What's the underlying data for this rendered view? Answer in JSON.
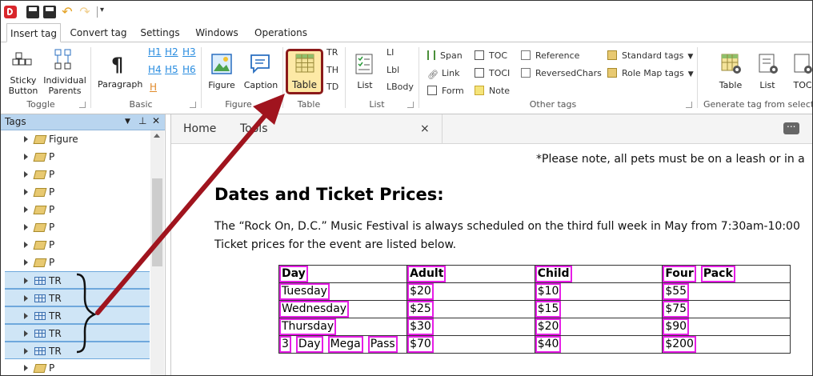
{
  "qat": {
    "icons": [
      "app-logo-icon",
      "save-icon",
      "save-as-icon",
      "undo-icon",
      "redo-icon",
      "customize-dropdown-icon"
    ]
  },
  "ribbon_tabs": [
    "Insert tag",
    "Convert tag",
    "Settings",
    "Windows",
    "Operations"
  ],
  "toggle_group": {
    "sticky": "Sticky Button",
    "individual": "Individual Parents",
    "label": "Toggle"
  },
  "basic_group": {
    "paragraph": "Paragraph",
    "h1": "H1",
    "h2": "H2",
    "h3": "H3",
    "h4": "H4",
    "h5": "H5",
    "h6": "H6",
    "h": "H",
    "label": "Basic"
  },
  "figure_group": {
    "figure": "Figure",
    "caption": "Caption",
    "label": "Figure"
  },
  "table_group": {
    "table": "Table",
    "tr": "TR",
    "th": "TH",
    "td": "TD",
    "label": "Table"
  },
  "list_group": {
    "list": "List",
    "li": "LI",
    "lbl": "Lbl",
    "lbody": "LBody",
    "label": "List"
  },
  "other_group": {
    "span": "Span",
    "link": "Link",
    "form": "Form",
    "toc": "TOC",
    "toci": "TOCI",
    "note": "Note",
    "reference": "Reference",
    "reversed": "ReversedChars",
    "standard": "Standard tags",
    "rolemap": "Role Map tags",
    "label": "Other tags"
  },
  "generate_group": {
    "table": "Table",
    "list": "List",
    "toc": "TOC",
    "label": "Generate tag from selectio"
  },
  "tags_pane": {
    "title": "Tags",
    "nodes": [
      {
        "label": "Figure",
        "type": "tag"
      },
      {
        "label": "P",
        "type": "tag"
      },
      {
        "label": "P",
        "type": "tag"
      },
      {
        "label": "P",
        "type": "tag"
      },
      {
        "label": "P",
        "type": "tag"
      },
      {
        "label": "P",
        "type": "tag"
      },
      {
        "label": "P",
        "type": "tag"
      },
      {
        "label": "P",
        "type": "tag"
      },
      {
        "label": "TR",
        "type": "tr"
      },
      {
        "label": "TR",
        "type": "tr"
      },
      {
        "label": "TR",
        "type": "tr"
      },
      {
        "label": "TR",
        "type": "tr"
      },
      {
        "label": "TR",
        "type": "tr"
      },
      {
        "label": "P",
        "type": "tag"
      }
    ]
  },
  "doc_tabs": {
    "home": "Home",
    "tools": "Tools",
    "close": "×"
  },
  "document": {
    "note": "*Please note, all pets must be on a leash or in a",
    "heading": "Dates and Ticket Prices:",
    "para1": "The “Rock On, D.C.” Music Festival is always scheduled on the third full week in May from 7:30am-10:00",
    "para2": "Ticket prices for the event are listed below.",
    "table": {
      "header": [
        [
          "Day"
        ],
        [
          "Adult"
        ],
        [
          "Child"
        ],
        [
          "Four",
          "Pack"
        ]
      ],
      "rows": [
        [
          [
            "Tuesday"
          ],
          [
            "$20"
          ],
          [
            "$10"
          ],
          [
            "$55"
          ]
        ],
        [
          [
            "Wednesday"
          ],
          [
            "$25"
          ],
          [
            "$15"
          ],
          [
            "$75"
          ]
        ],
        [
          [
            "Thursday"
          ],
          [
            "$30"
          ],
          [
            "$20"
          ],
          [
            "$90"
          ]
        ],
        [
          [
            "3",
            "Day",
            "Mega",
            "Pass"
          ],
          [
            "$70"
          ],
          [
            "$40"
          ],
          [
            "$200"
          ]
        ]
      ]
    }
  },
  "colors": {
    "arrow": "#a0141e",
    "highlight": "#e61ee6",
    "selection": "#cfe5f6",
    "pane_header": "#b9d5ef"
  }
}
